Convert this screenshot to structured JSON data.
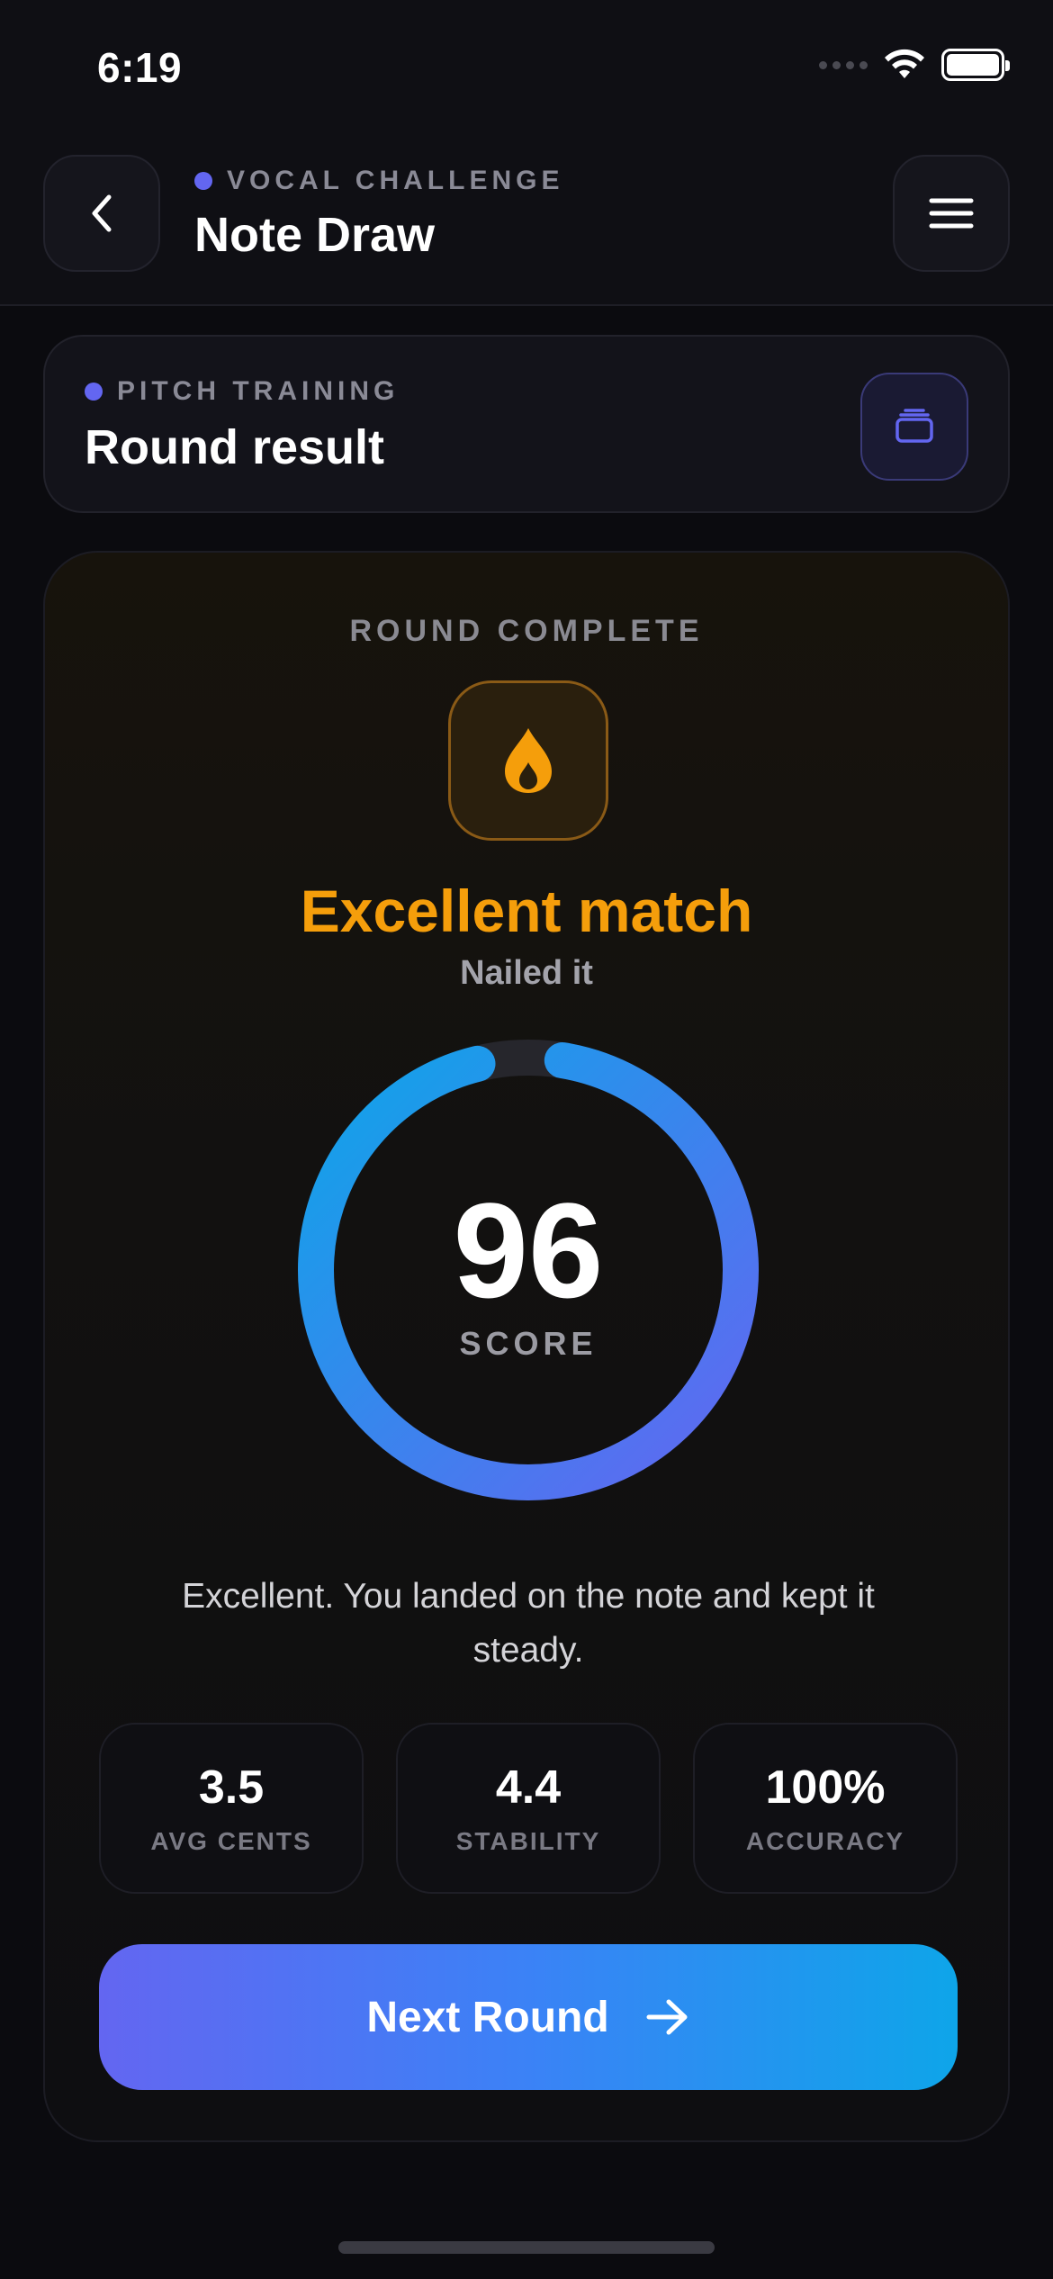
{
  "status_bar": {
    "time": "6:19"
  },
  "header": {
    "eyebrow": "VOCAL CHALLENGE",
    "title": "Note Draw",
    "back_icon": "chevron-left-icon",
    "menu_icon": "hamburger-menu-icon"
  },
  "section": {
    "eyebrow": "PITCH TRAINING",
    "title": "Round result",
    "action_icon": "card-stack-icon"
  },
  "result": {
    "label": "ROUND COMPLETE",
    "icon": "flame-icon",
    "title": "Excellent match",
    "subtitle": "Nailed it",
    "score": {
      "value": "96",
      "label": "SCORE",
      "progress_fraction": 0.96
    },
    "feedback": "Excellent. You landed on the note and kept it steady.",
    "stats": [
      {
        "value": "3.5",
        "label": "AVG CENTS"
      },
      {
        "value": "4.4",
        "label": "STABILITY"
      },
      {
        "value": "100%",
        "label": "ACCURACY"
      }
    ],
    "next_button": {
      "label": "Next Round",
      "icon": "arrow-right-icon"
    }
  },
  "colors": {
    "accent_purple": "#6366f1",
    "accent_blue": "#0ea5e9",
    "result_orange": "#f59e0b",
    "background": "#0b0b0f"
  }
}
